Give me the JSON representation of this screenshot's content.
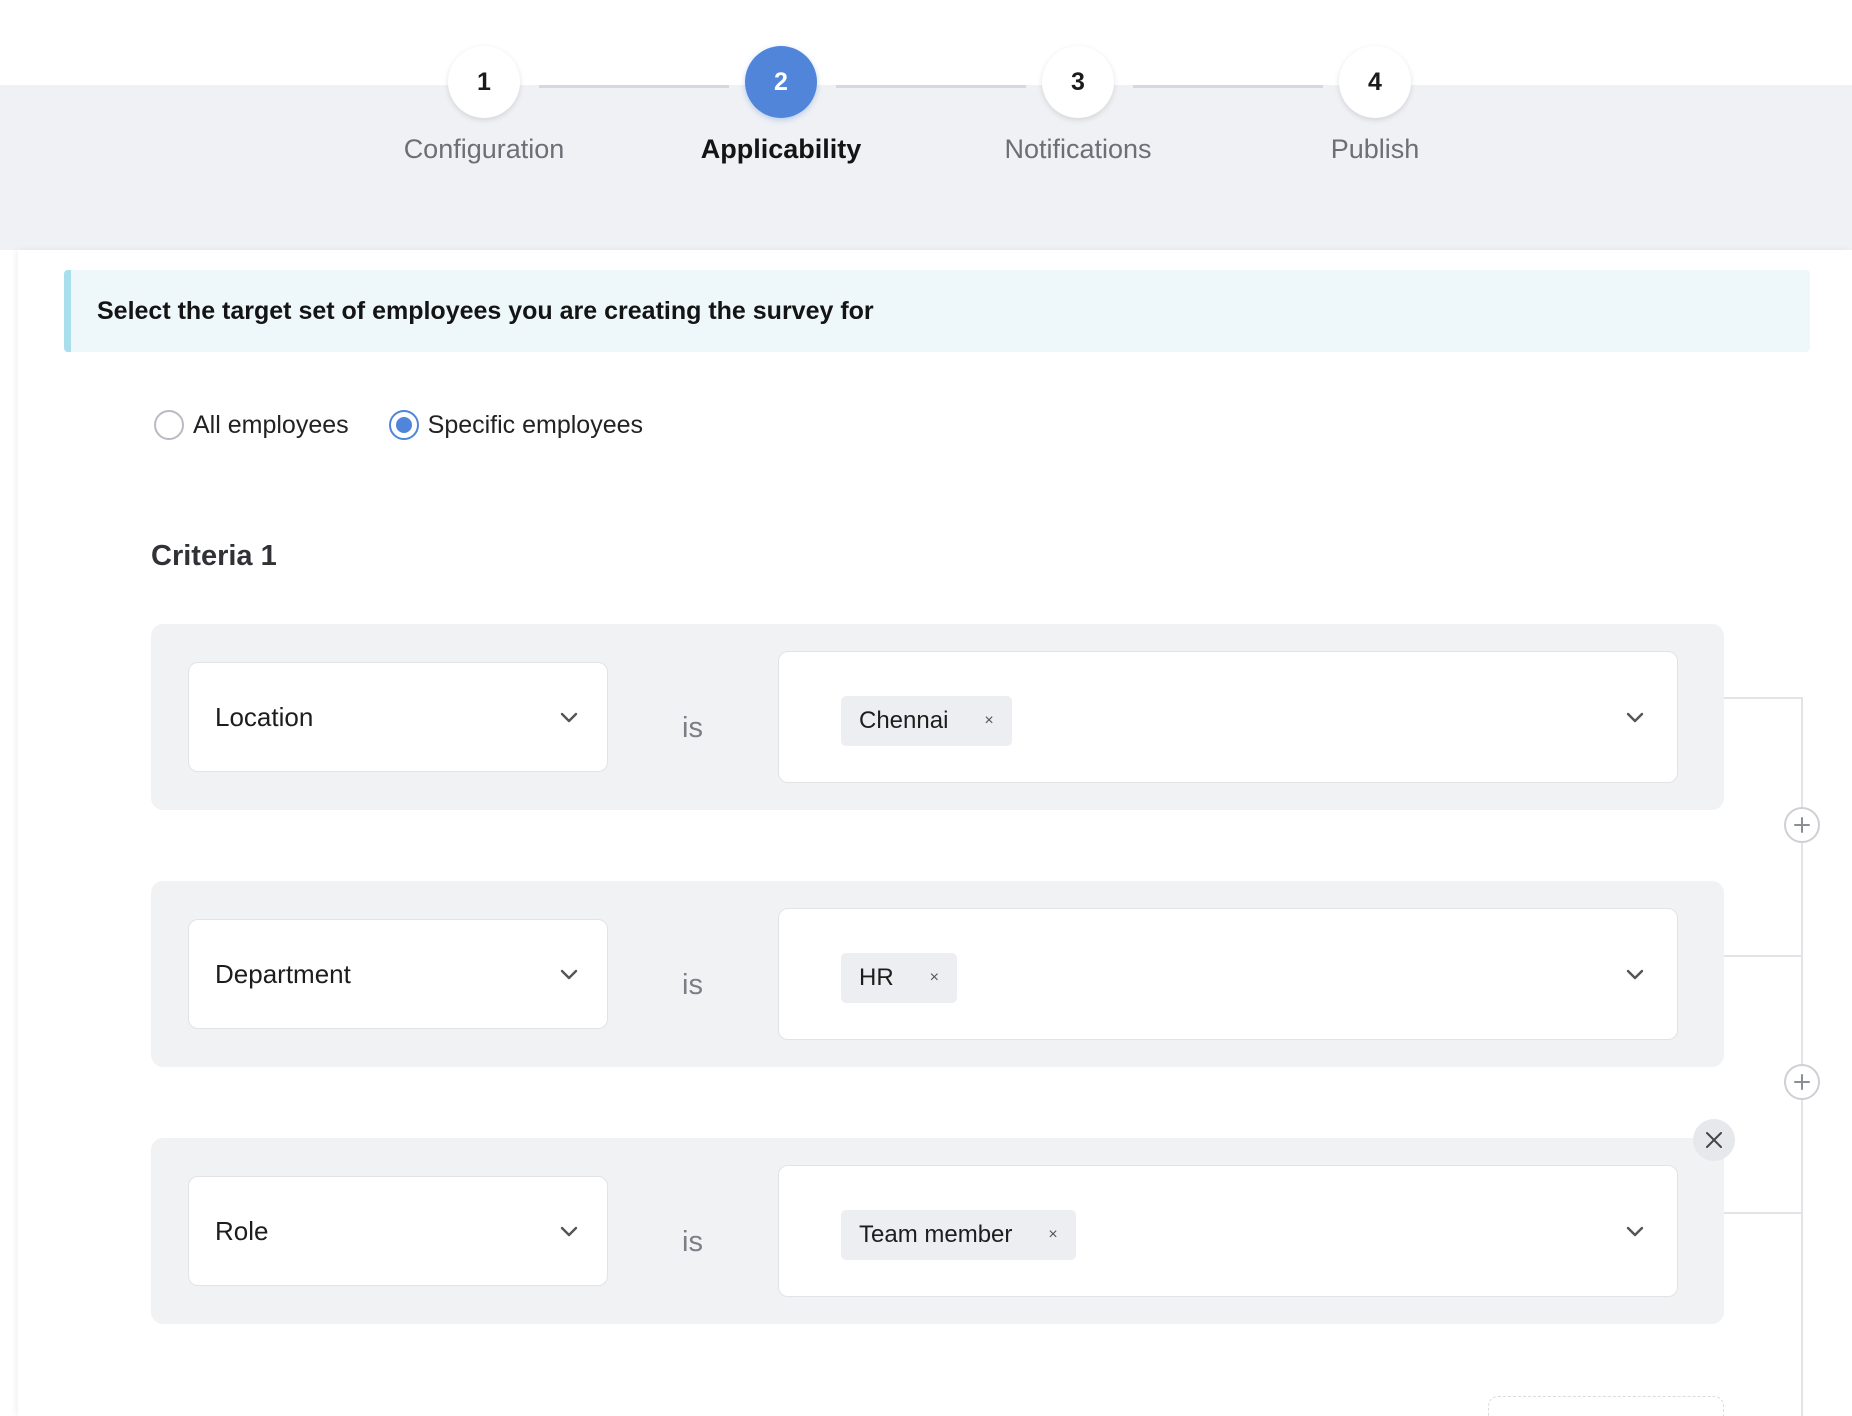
{
  "stepper": {
    "steps": [
      {
        "number": "1",
        "label": "Configuration",
        "active": false
      },
      {
        "number": "2",
        "label": "Applicability",
        "active": true
      },
      {
        "number": "3",
        "label": "Notifications",
        "active": false
      },
      {
        "number": "4",
        "label": "Publish",
        "active": false
      }
    ]
  },
  "banner": {
    "text": "Select the target set of employees you are creating the survey for"
  },
  "target": {
    "options": [
      {
        "label": "All employees",
        "checked": false
      },
      {
        "label": "Specific employees",
        "checked": true
      }
    ]
  },
  "criteria": {
    "title": "Criteria 1",
    "rows": [
      {
        "field": "Location",
        "operator": "is",
        "values": [
          "Chennai"
        ]
      },
      {
        "field": "Department",
        "operator": "is",
        "values": [
          "HR"
        ]
      },
      {
        "field": "Role",
        "operator": "is",
        "values": [
          "Team member"
        ]
      }
    ]
  },
  "icons": {
    "chip_remove": "×",
    "chevron": "chevron-down-icon",
    "add": "plus-icon",
    "close": "close-icon"
  },
  "colors": {
    "accent": "#5185d9",
    "band": "#eff1f4",
    "banner_bg": "#eef7fa",
    "banner_border": "#a9dfec",
    "row_bg": "#f1f2f4"
  }
}
